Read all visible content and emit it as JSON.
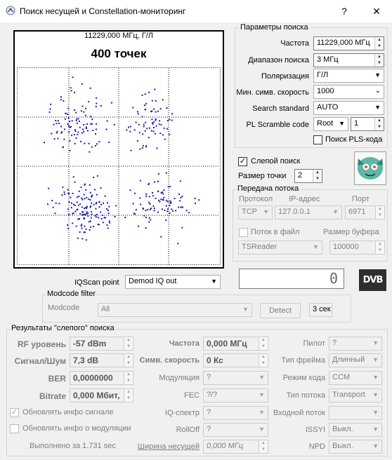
{
  "window": {
    "title": "Поиск несущей и Constellation-мониторинг",
    "help_label": "?",
    "close_label": "✕"
  },
  "constellation": {
    "freq_header": "11229,000 МГц, Г/Л",
    "points_header": "400 точек"
  },
  "search_params": {
    "title": "Параметры поиска",
    "freq_label": "Частота",
    "freq_value": "11229,000 МГц",
    "range_label": "Диапазон поиска",
    "range_value": "3 МГц",
    "pol_label": "Поляризация",
    "pol_value": "Г/Л",
    "symrate_label": "Мин. симв. скорость",
    "symrate_value": "1000",
    "standard_label": "Search standard",
    "standard_value": "AUTO",
    "scramble_label": "PL Scramble code",
    "scramble_mode": "Root",
    "scramble_value": "1",
    "pls_label": "Поиск PLS-кода"
  },
  "blind": {
    "blind_label": "Слепой поиск",
    "blind_checked": "✓",
    "point_size_label": "Размер точки",
    "point_size_value": "2"
  },
  "stream": {
    "title": "Передача потока",
    "protocol_header": "Протокол",
    "ip_header": "IP-адрес",
    "port_header": "Порт",
    "protocol_value": "TCP",
    "ip_value": "127.0.0.1",
    "port_value": "6971",
    "file_label": "Поток в файл",
    "buffer_label": "Размер буфера",
    "reader_value": "TSReader",
    "buffer_value": "100000"
  },
  "iqscan": {
    "label": "IQScan point",
    "value": "Demod IQ out",
    "counter": "0",
    "logo": "DVB"
  },
  "modcode": {
    "title": "Modcode filter",
    "label": "Modcode",
    "value": "All",
    "detect_label": "Detect",
    "seconds_value": "3 сек"
  },
  "results": {
    "title": "Результаты \"слепого\" поиска",
    "rf_label": "RF уровень",
    "rf_value": "-57 dBm",
    "snr_label": "Сигнал/Шум",
    "snr_value": "7,3 dB",
    "ber_label": "BER",
    "ber_value": "0,0000000",
    "bitrate_label": "Bitrate",
    "bitrate_value": "0,000 Мбит,",
    "freq_label": "Частота",
    "freq_value": "0,000 МГц",
    "symrate_label": "Симв. скорость",
    "symrate_value": "0 Кс",
    "modulation_label": "Модуляция",
    "modulation_value": "?",
    "fec_label": "FEC",
    "fec_value": "?/?",
    "iq_label": "IQ-спектр",
    "iq_value": "?",
    "rolloff_label": "RollOff",
    "rolloff_value": "?",
    "bandwidth_label": "Ширина несущей",
    "bandwidth_value": "0,000 МГц",
    "pilot_label": "Пилот",
    "pilot_value": "?",
    "frame_label": "Тип фрейма",
    "frame_value": "Длинный",
    "codemode_label": "Режим кода",
    "codemode_value": "CCM",
    "streamtype_label": "Тип потока",
    "streamtype_value": "Transport",
    "input_label": "Входной поток",
    "input_value": "",
    "issyi_label": "ISSYI",
    "issyi_value": "Выкл.",
    "npd_label": "NPD",
    "npd_value": "Выкл.",
    "update_signal_label": "Обновлять инфо сигнале",
    "update_signal_check": "✓",
    "update_mod_label": "Обновлять инфо о модуляции",
    "done_label": "Выполнено за 1.731 sec"
  }
}
